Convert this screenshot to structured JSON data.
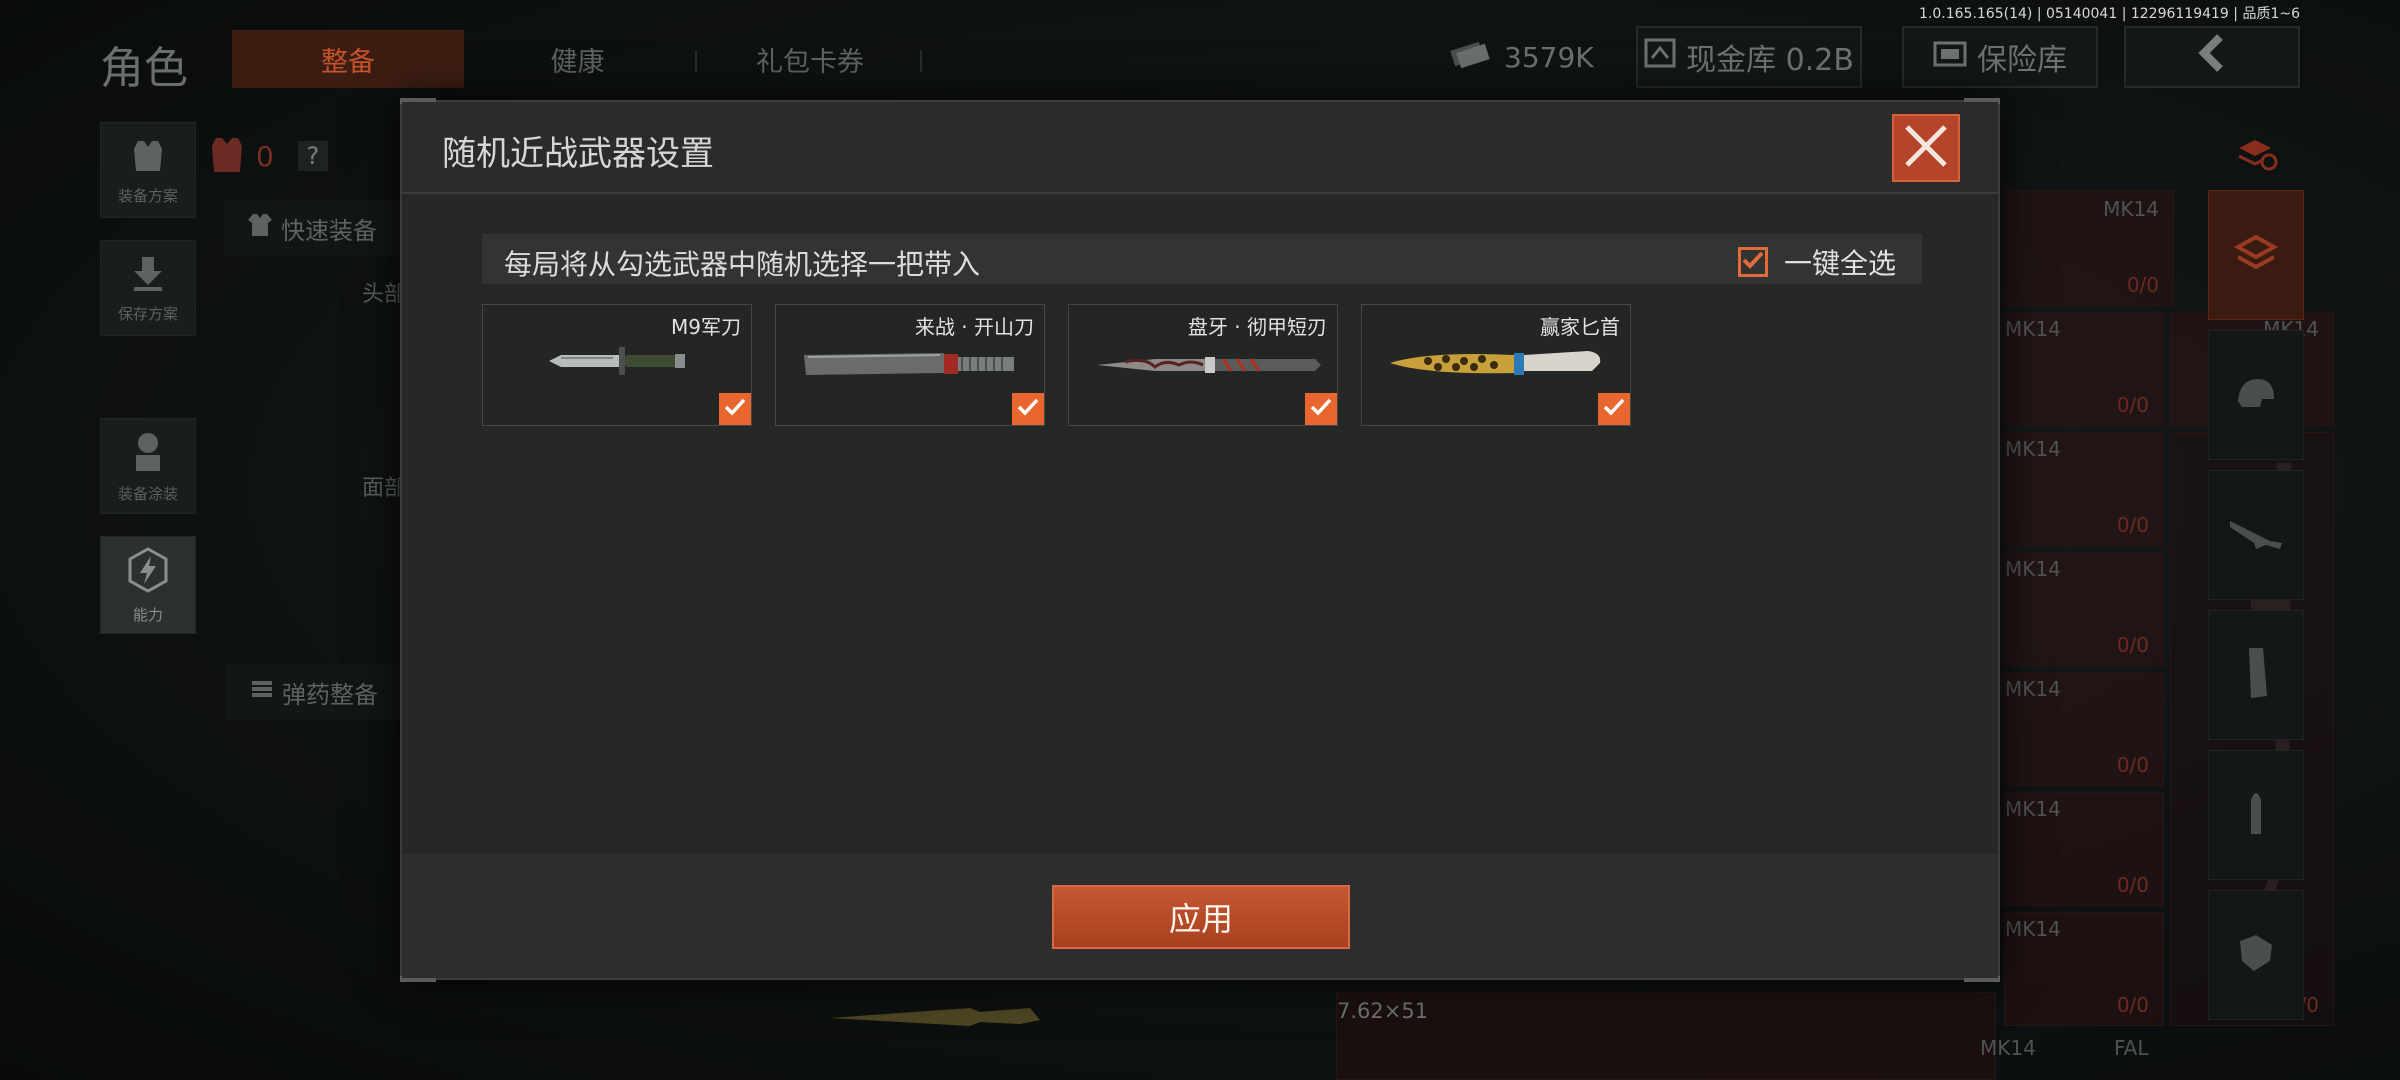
{
  "version_info": "1.0.165.165(14) | 05140041 | 12296119419 | 品质1~6",
  "header": {
    "title": "角色",
    "tabs": [
      {
        "label": "整备",
        "active": true
      },
      {
        "label": "健康",
        "active": false
      },
      {
        "label": "礼包卡券",
        "active": false
      }
    ],
    "currency_amount": "3579K",
    "cash_vault": "现金库 0.2B",
    "safe_box": "保险库"
  },
  "sidebar": {
    "items": [
      {
        "label": "装备方案",
        "icon": "vest-icon"
      },
      {
        "label": "保存方案",
        "icon": "download-icon"
      },
      {
        "label": "装备涂装",
        "icon": "soldier-icon"
      },
      {
        "label": "能力",
        "icon": "lightning-icon"
      }
    ]
  },
  "loadout": {
    "armor_count": "0",
    "help": "?",
    "quick_equip": "快速装备",
    "head_label": "头部",
    "face_label": "面部",
    "ammo_prep": "弹药整备"
  },
  "right_panel": {
    "mk_labels": [
      "MK14",
      "MK14",
      "MK14",
      "MK14",
      "MK14",
      "MK14",
      "MK14",
      "MK14",
      "MK14",
      "FAL"
    ],
    "zero_label": "0/0",
    "caliber": "7.62×51"
  },
  "modal": {
    "title": "随机近战武器设置",
    "info_text": "每局将从勾选武器中随机选择一把带入",
    "select_all_label": "一键全选",
    "select_all_checked": true,
    "weapons": [
      {
        "name": "M9军刀",
        "checked": true
      },
      {
        "name": "来战 · 开山刀",
        "checked": true
      },
      {
        "name": "盘牙 · 彻甲短刃",
        "checked": true
      },
      {
        "name": "赢家匕首",
        "checked": true
      }
    ],
    "apply_label": "应用"
  },
  "colors": {
    "accent": "#e9662f",
    "accent_dark": "#b6442a",
    "modal_bg": "#262727"
  }
}
